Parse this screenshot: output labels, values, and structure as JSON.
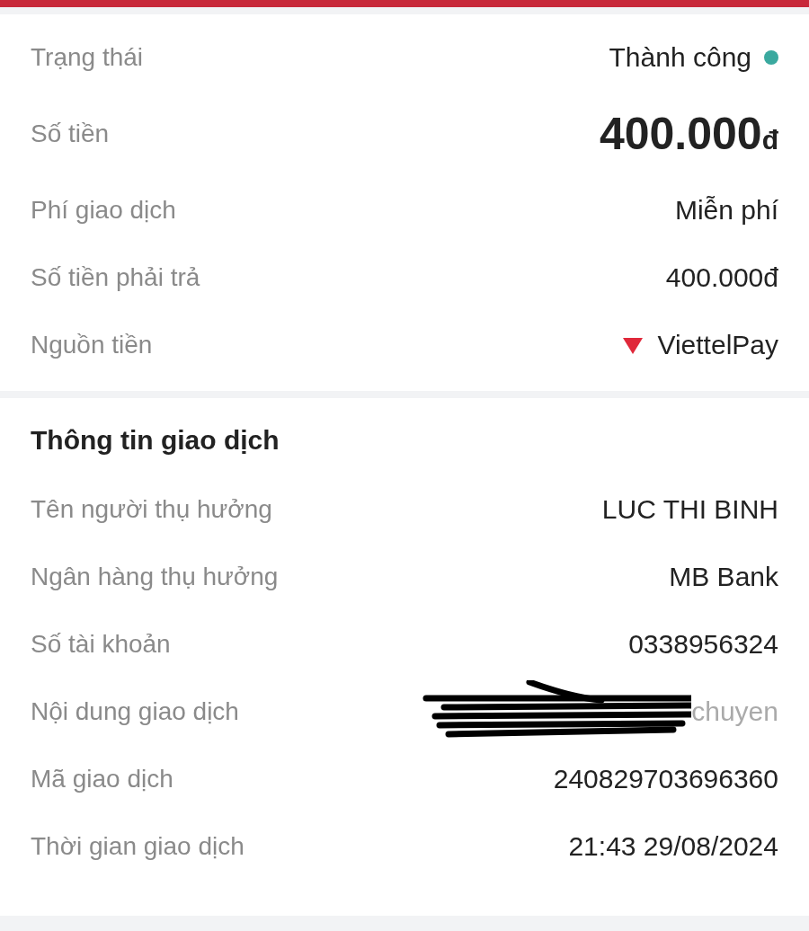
{
  "summary": [
    {
      "kind": "status",
      "label": "Trạng thái",
      "value": "Thành công",
      "color": "#3aa99f"
    },
    {
      "kind": "amount",
      "label": "Số tiền",
      "value": "400.000",
      "unit": "đ"
    },
    {
      "kind": "text",
      "label": "Phí giao dịch",
      "value": "Miễn phí"
    },
    {
      "kind": "text",
      "label": "Số tiền phải trả",
      "value": "400.000đ"
    },
    {
      "kind": "source",
      "label": "Nguồn tiền",
      "value": "ViettelPay"
    }
  ],
  "details": {
    "title": "Thông tin giao dịch",
    "rows": [
      {
        "kind": "text",
        "label": "Tên người thụ hưởng",
        "value": "LUC THI BINH"
      },
      {
        "kind": "text",
        "label": "Ngân hàng thụ hưởng",
        "value": "MB Bank"
      },
      {
        "kind": "text",
        "label": "Số tài khoản",
        "value": "0338956324"
      },
      {
        "kind": "redacted",
        "label": "Nội dung giao dịch",
        "value": "chuyen"
      },
      {
        "kind": "text",
        "label": "Mã giao dịch",
        "value": "240829703696360"
      },
      {
        "kind": "text",
        "label": "Thời gian giao dịch",
        "value": "21:43 29/08/2024"
      }
    ]
  }
}
